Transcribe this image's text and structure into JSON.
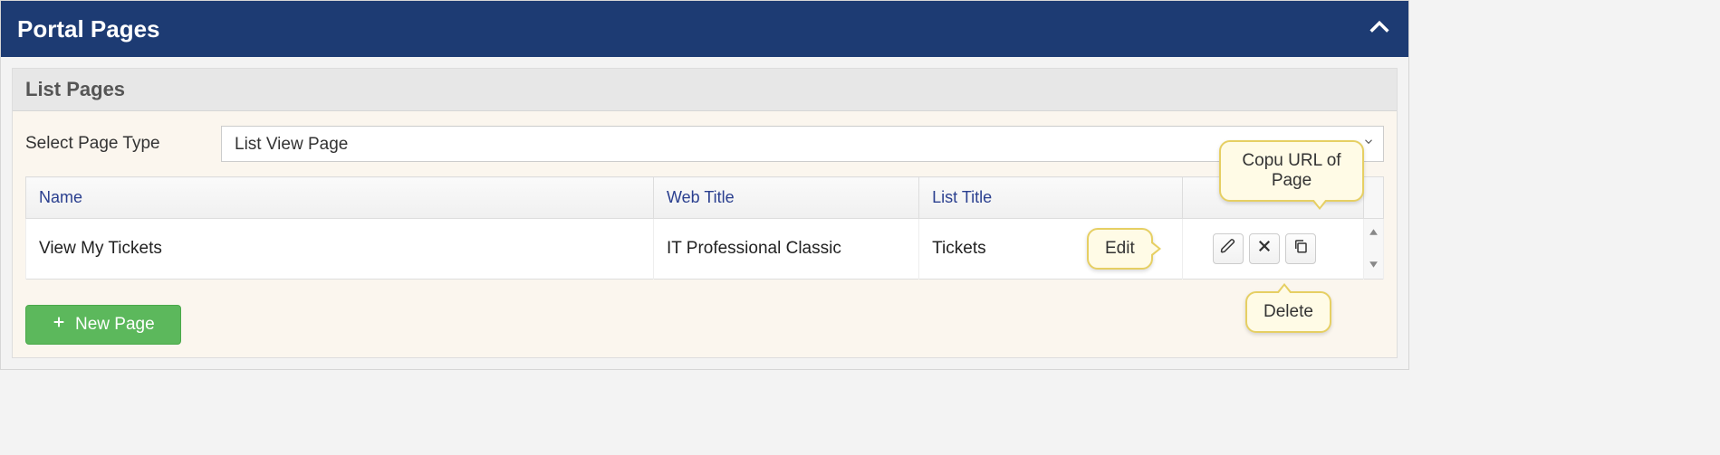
{
  "panel": {
    "title": "Portal Pages"
  },
  "sub": {
    "title": "List Pages"
  },
  "filter": {
    "label": "Select Page Type",
    "selected": "List View Page"
  },
  "table": {
    "columns": {
      "name": "Name",
      "web_title": "Web Title",
      "list_title": "List Title"
    },
    "rows": [
      {
        "name": "View My Tickets",
        "web_title": "IT Professional Classic",
        "list_title": "Tickets"
      }
    ]
  },
  "buttons": {
    "new_page": "New Page"
  },
  "callouts": {
    "edit": "Edit",
    "delete": "Delete",
    "copy": "Copu URL of Page"
  }
}
